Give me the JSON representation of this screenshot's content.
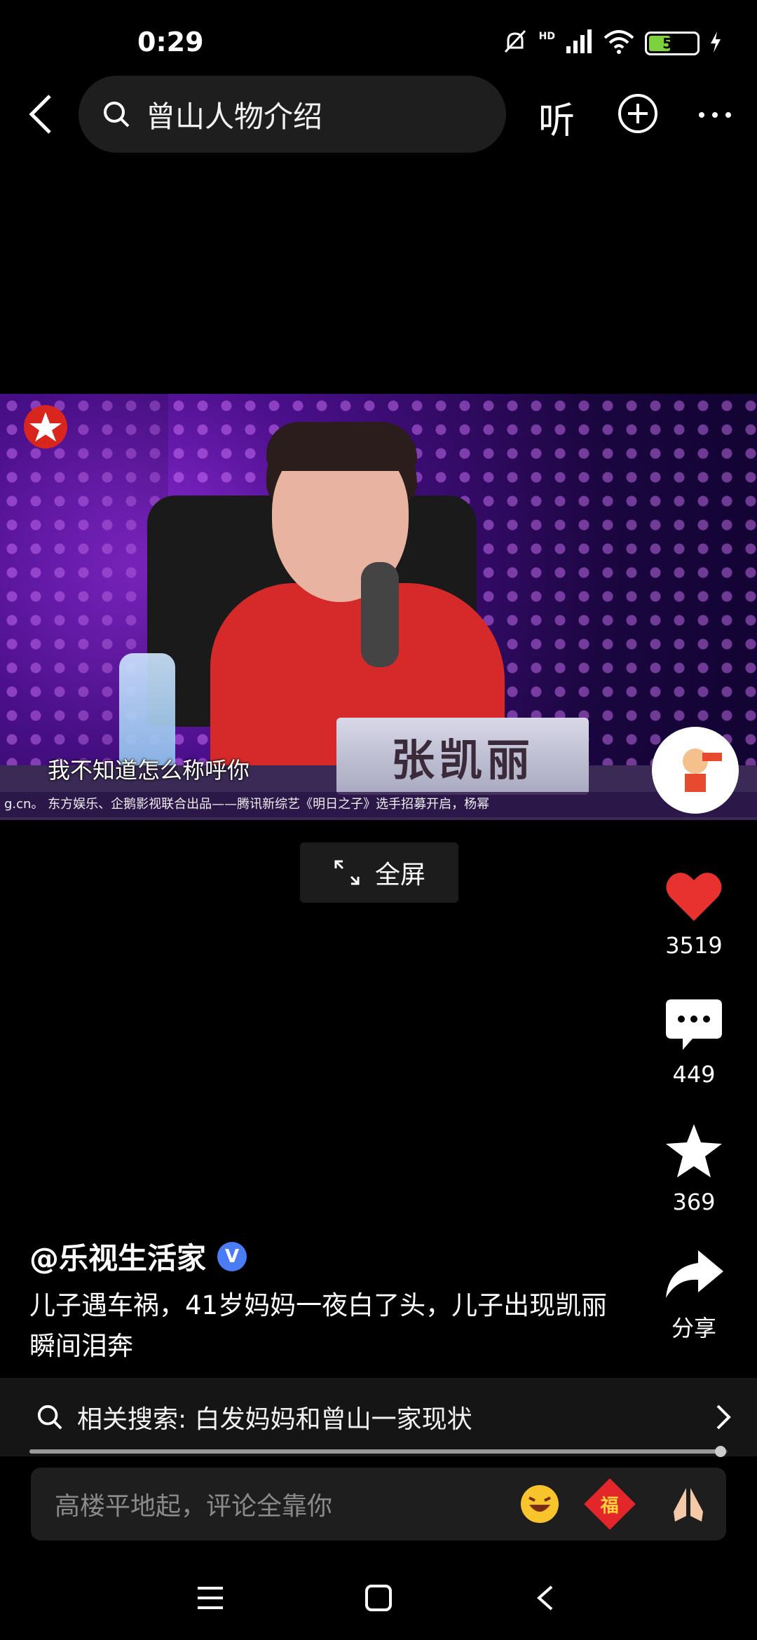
{
  "status_bar": {
    "time": "0:29",
    "hd_label": "HD",
    "battery_level": "50",
    "battery_fraction": 0.5
  },
  "search": {
    "query": "曾山人物介绍"
  },
  "header": {
    "listen_label": "听"
  },
  "video": {
    "nameplate": "张凯丽",
    "subtitle": "我不知道怎么称呼你",
    "ticker": "g.cn。    东方娱乐、企鹅影视联合出品——腾讯新综艺《明日之子》选手招募开启，杨幂"
  },
  "fullscreen": {
    "label": "全屏"
  },
  "actions": {
    "likes": "3519",
    "comments": "449",
    "favorites": "369",
    "share_label": "分享"
  },
  "post": {
    "author": "@乐视生活家",
    "verified_badge": "V",
    "caption": "儿子遇车祸，41岁妈妈一夜白了头，儿子出现凯丽瞬间泪奔"
  },
  "related": {
    "label": "相关搜索: 白发妈妈和曾山一家现状"
  },
  "progress": {
    "fraction": 0.99
  },
  "comment": {
    "placeholder": "高楼平地起，评论全靠你",
    "fu_char": "福"
  },
  "colors": {
    "like": "#e8322f",
    "background": "#000000",
    "verified": "#4a7cf5"
  }
}
